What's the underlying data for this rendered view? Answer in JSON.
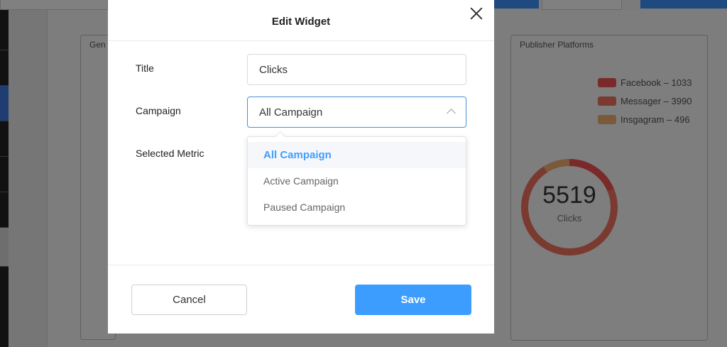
{
  "background": {
    "panel_left_title": "Gen",
    "panel_right_title": "Publisher Platforms",
    "legend": [
      {
        "label": "Facebook – 1033",
        "color": "#7a2a2a"
      },
      {
        "label": "Messager – 3990",
        "color": "#7a3a30"
      },
      {
        "label": "Insgagram – 496",
        "color": "#7a5a3a"
      }
    ],
    "donut": {
      "value": "5519",
      "label": "Clicks",
      "segments": [
        {
          "name": "Facebook",
          "value": 1033,
          "color": "#7a2a2a"
        },
        {
          "name": "Messager",
          "value": 3990,
          "color": "#7a3a30"
        },
        {
          "name": "Insgagram",
          "value": 496,
          "color": "#7a5a3a"
        }
      ]
    }
  },
  "modal": {
    "title": "Edit Widget",
    "title_label": "Title",
    "title_value": "Clicks",
    "campaign_label": "Campaign",
    "campaign_value": "All Campaign",
    "metric_label": "Selected Metric",
    "campaign_options": [
      {
        "label": "All Campaign",
        "selected": true
      },
      {
        "label": "Active Campaign",
        "selected": false
      },
      {
        "label": "Paused Campaign",
        "selected": false
      }
    ],
    "cancel_label": "Cancel",
    "save_label": "Save"
  }
}
